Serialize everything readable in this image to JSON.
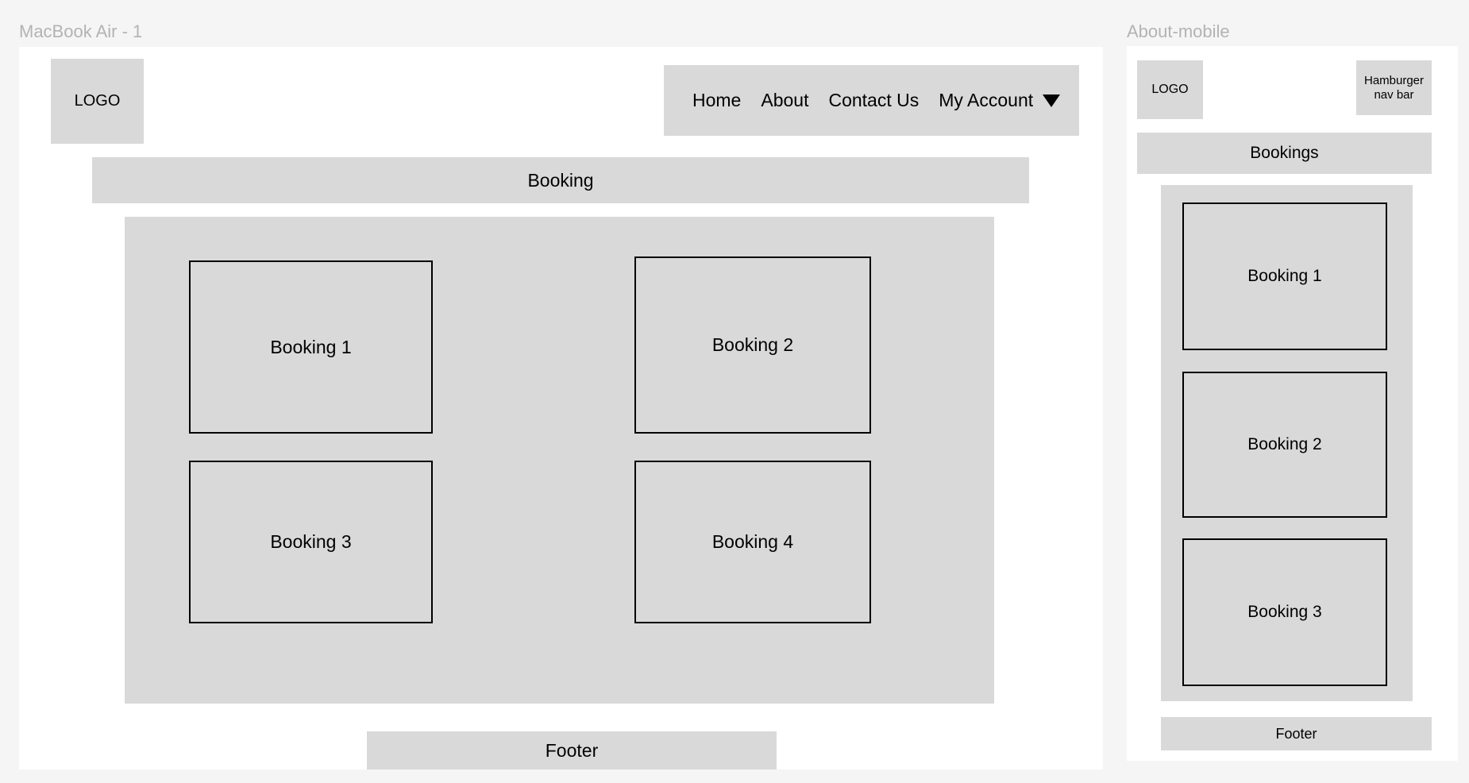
{
  "desktop": {
    "frame_label": "MacBook Air - 1",
    "logo": "LOGO",
    "nav": {
      "home": "Home",
      "about": "About",
      "contact": "Contact Us",
      "account": "My Account",
      "account_icon": "caret-down-icon"
    },
    "section_title": "Booking",
    "bookings": [
      "Booking 1",
      "Booking 2",
      "Booking 3",
      "Booking 4"
    ],
    "footer": "Footer"
  },
  "mobile": {
    "frame_label": "About-mobile",
    "logo": "LOGO",
    "menu_label": "Hamburger\nnav bar",
    "section_title": "Bookings",
    "bookings": [
      "Booking 1",
      "Booking 2",
      "Booking 3"
    ],
    "footer": "Footer"
  },
  "colors": {
    "canvas": "#f5f5f5",
    "frame": "#ffffff",
    "placeholder": "#d9d9d9",
    "label": "#b3b3b3"
  }
}
